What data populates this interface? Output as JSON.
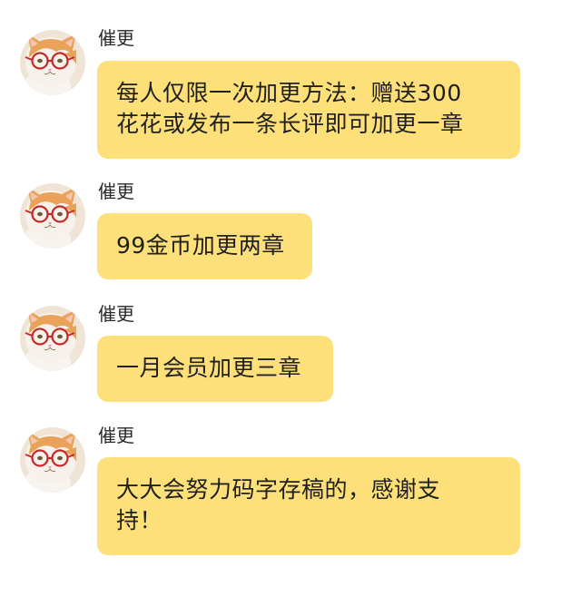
{
  "colors": {
    "bubble": "#fde079",
    "text": "#202020",
    "background": "#ffffff"
  },
  "messages": [
    {
      "sender": "催更",
      "avatar_icon": "cat-with-glasses-icon",
      "lines": [
        "每人仅限一次加更方法：赠送300",
        "花花或发布一条长评即可加更一章"
      ]
    },
    {
      "sender": "催更",
      "avatar_icon": "cat-with-glasses-icon",
      "lines": [
        "99金币加更两章"
      ]
    },
    {
      "sender": "催更",
      "avatar_icon": "cat-with-glasses-icon",
      "lines": [
        "一月会员加更三章"
      ]
    },
    {
      "sender": "催更",
      "avatar_icon": "cat-with-glasses-icon",
      "lines": [
        "大大会努力码字存稿的，感谢支",
        "持！"
      ]
    }
  ]
}
